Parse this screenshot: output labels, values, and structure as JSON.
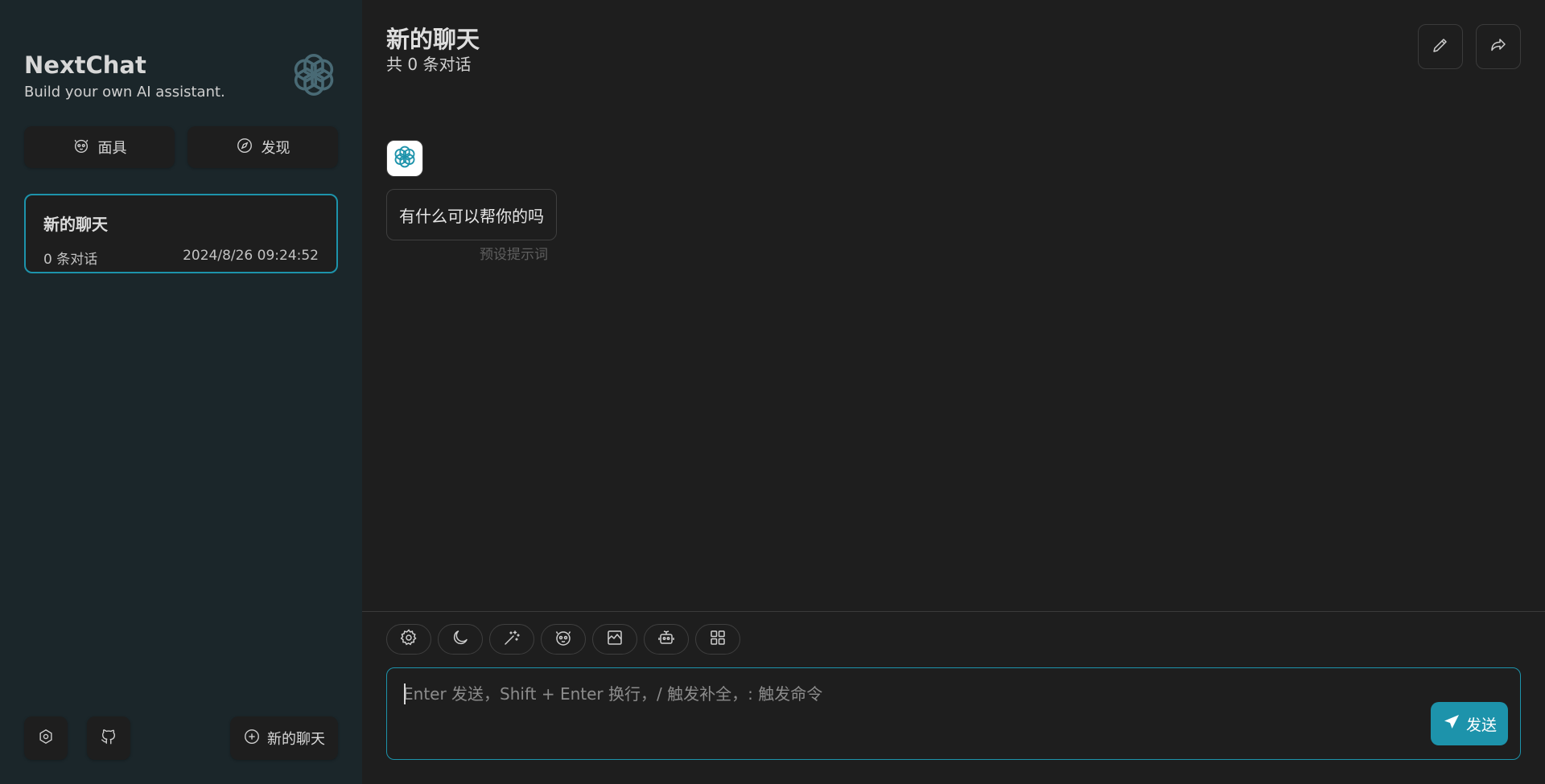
{
  "sidebar": {
    "brand_title": "NextChat",
    "brand_subtitle": "Build your own AI assistant.",
    "mask_label": "面具",
    "discover_label": "发现",
    "chat_item": {
      "title": "新的聊天",
      "count": "0 条对话",
      "time": "2024/8/26 09:24:52"
    },
    "new_chat_label": "新的聊天"
  },
  "header": {
    "title": "新的聊天",
    "subtitle": "共 0 条对话"
  },
  "message": {
    "text": "有什么可以帮你的吗",
    "hint": "预设提示词"
  },
  "input": {
    "placeholder": "Enter 发送，Shift + Enter 换行，/ 触发补全，: 触发命令"
  },
  "send_label": "发送",
  "colors": {
    "accent": "#1d93ab",
    "sidebar_bg": "#1b262a",
    "main_bg": "#1e1e1e"
  }
}
